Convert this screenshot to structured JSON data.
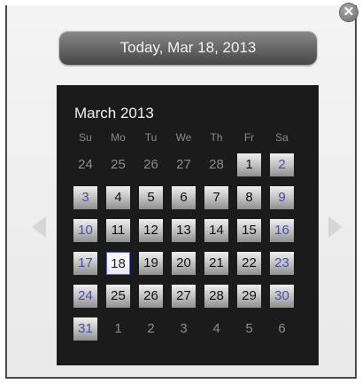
{
  "close_label": "✕",
  "today_button": "Today, Mar 18, 2013",
  "calendar": {
    "month_title": "March 2013",
    "weekdays": [
      "Su",
      "Mo",
      "Tu",
      "We",
      "Th",
      "Fr",
      "Sa"
    ],
    "weeks": [
      [
        "24",
        "25",
        "26",
        "27",
        "28",
        "1",
        "2"
      ],
      [
        "3",
        "4",
        "5",
        "6",
        "7",
        "8",
        "9"
      ],
      [
        "10",
        "11",
        "12",
        "13",
        "14",
        "15",
        "16"
      ],
      [
        "17",
        "18",
        "19",
        "20",
        "21",
        "22",
        "23"
      ],
      [
        "24",
        "25",
        "26",
        "27",
        "28",
        "29",
        "30"
      ],
      [
        "31",
        "1",
        "2",
        "3",
        "4",
        "5",
        "6"
      ]
    ],
    "selected_day": "18"
  },
  "colors": {
    "calendar_bg": "#1b1b1b",
    "weekend_text": "#4b4ea3",
    "today_border": "#5f63c6"
  },
  "icons": {
    "close": "close-icon",
    "prev": "chevron-left-icon",
    "next": "chevron-right-icon"
  }
}
